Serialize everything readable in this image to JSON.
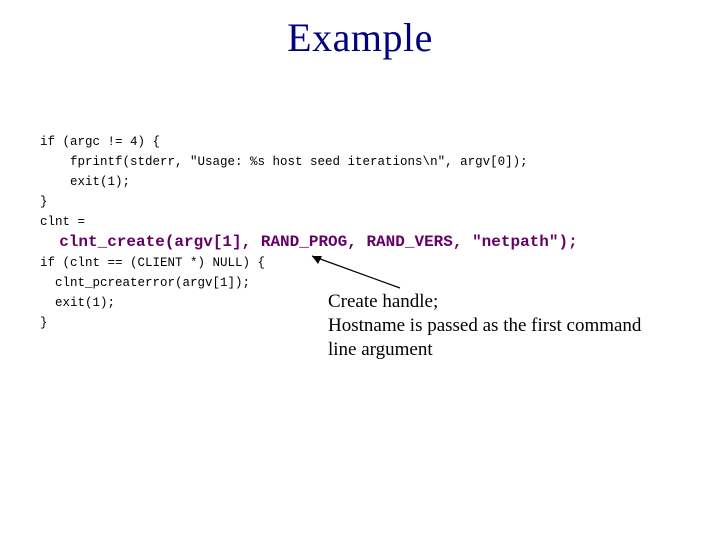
{
  "title": "Example",
  "code": {
    "l1": "if (argc != 4) {",
    "l2": "    fprintf(stderr, \"Usage: %s host seed iterations\\n\", argv[0]);",
    "l3": "    exit(1);",
    "l4": "}",
    "l5": "clnt =",
    "emph": "  clnt_create(argv[1], RAND_PROG, RAND_VERS, \"netpath\");",
    "l6": "if (clnt == (CLIENT *) NULL) {",
    "l7": "  clnt_pcreaterror(argv[1]);",
    "l8": "  exit(1);",
    "l9": "}"
  },
  "annotation": {
    "line1": "Create handle;",
    "line2": "Hostname is passed as the first command",
    "line3": "line argument"
  }
}
